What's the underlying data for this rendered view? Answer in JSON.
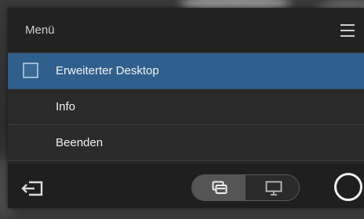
{
  "menu": {
    "title": "Menü",
    "items": [
      {
        "label": "Erweiterter Desktop",
        "selected": true,
        "checked": false
      },
      {
        "label": "Info",
        "selected": false
      },
      {
        "label": "Beenden",
        "selected": false
      }
    ]
  },
  "footer": {
    "exit_icon": "exit-icon",
    "view_toggle": {
      "options": [
        "windows-icon",
        "monitor-icon"
      ],
      "active": "windows-icon"
    },
    "circle_button_icon": "circle-icon"
  },
  "colors": {
    "selected_row": "#2f5f8c",
    "panel": "#262626",
    "toggle_active": "#555555"
  }
}
